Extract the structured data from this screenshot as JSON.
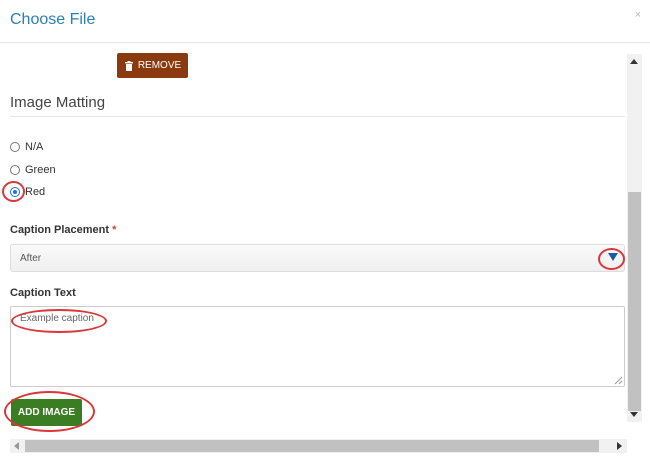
{
  "header": {
    "title": "Choose File",
    "close_glyph": "×"
  },
  "remove_button": {
    "label": "REMOVE",
    "icon": "trash-icon",
    "color": "#8b3a0f"
  },
  "matting": {
    "title": "Image Matting",
    "options": [
      "N/A",
      "Green",
      "Red"
    ],
    "selected": "Red"
  },
  "caption_placement": {
    "label": "Caption Placement",
    "required_mark": "*",
    "value": "After"
  },
  "caption_text": {
    "label": "Caption Text",
    "value": "Example caption"
  },
  "add_button": {
    "label": "ADD IMAGE",
    "color": "#3a7d23"
  },
  "colors": {
    "title_blue": "#2a7fb8",
    "annotation_red": "#d9383a"
  }
}
